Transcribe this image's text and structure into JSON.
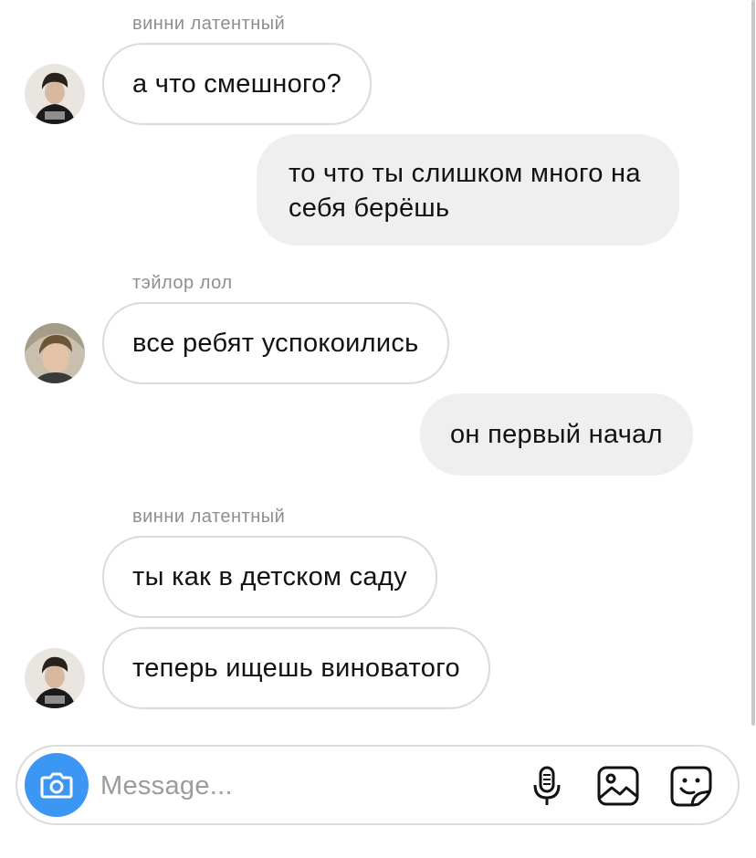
{
  "conversation": {
    "groups": [
      {
        "sender": "винни латентный",
        "messages": [
          "а что смешного?"
        ]
      },
      {
        "outgoing": [
          "то что ты слишком много на",
          "себя берёшь"
        ]
      },
      {
        "sender": "тэйлор лол",
        "messages": [
          "все ребят успокоились"
        ]
      },
      {
        "outgoing": [
          "он первый начал"
        ]
      },
      {
        "sender": "винни латентный",
        "messages": [
          "ты как в детском саду",
          "теперь ищешь виноватого"
        ]
      }
    ]
  },
  "composer": {
    "placeholder": "Message...",
    "icons": [
      "camera-icon",
      "microphone-icon",
      "gallery-icon",
      "sticker-icon"
    ],
    "accent_color": "#3c96f3"
  },
  "colors": {
    "incoming_bubble_border": "#dbdbdb",
    "outgoing_bubble_bg": "#efefef",
    "sender_name": "#8e8e8e"
  }
}
